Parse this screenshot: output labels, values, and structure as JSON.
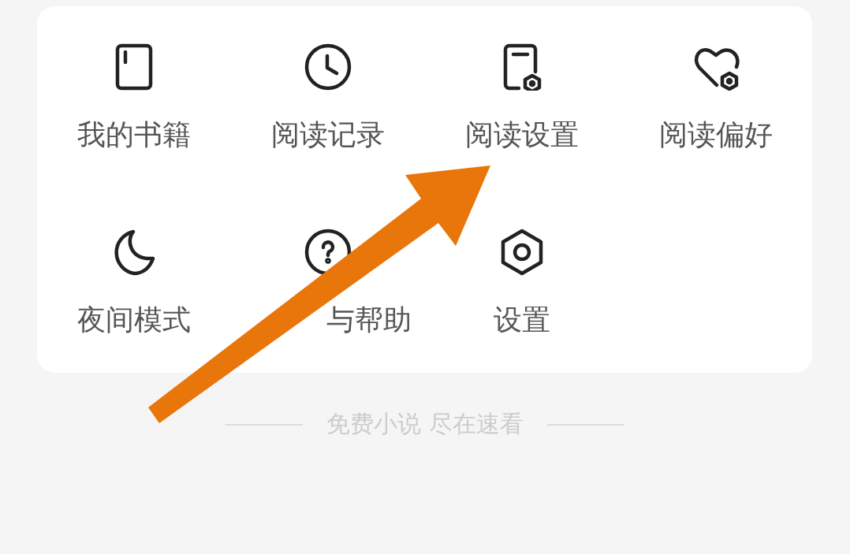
{
  "menu": {
    "items": [
      {
        "kind": "book",
        "label": "我的书籍"
      },
      {
        "kind": "clock",
        "label": "阅读记录"
      },
      {
        "kind": "doc-settings",
        "label": "阅读设置"
      },
      {
        "kind": "heart-settings",
        "label": "阅读偏好"
      },
      {
        "kind": "moon",
        "label": "夜间模式"
      },
      {
        "kind": "help",
        "label": "与帮助",
        "covered_start": true
      },
      {
        "kind": "settings",
        "label": "设置"
      }
    ]
  },
  "footer": {
    "slogan": "免费小说 尽在速看"
  }
}
